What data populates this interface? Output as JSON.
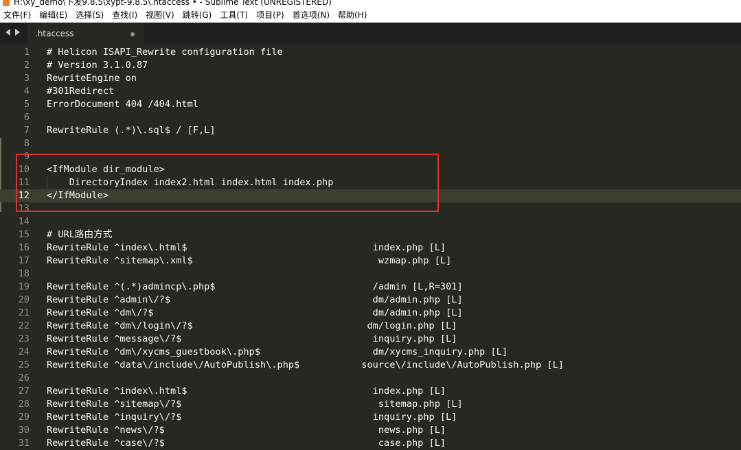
{
  "window": {
    "title": "H:\\xy_demo\\下发9.8.5\\xypt-9.8.5\\.htaccess • - Sublime Text (UNREGISTERED)"
  },
  "menu": [
    "文件(F)",
    "编辑(E)",
    "选择(S)",
    "查找(I)",
    "视图(V)",
    "跳转(G)",
    "工具(T)",
    "项目(P)",
    "首选项(N)",
    "帮助(H)"
  ],
  "tabs": [
    {
      "label": ".htaccess",
      "modified": true
    }
  ],
  "editor": {
    "current_line": 12,
    "lines": [
      {
        "n": "1",
        "text": "# Helicon ISAPI_Rewrite configuration file"
      },
      {
        "n": "2",
        "text": "# Version 3.1.0.87"
      },
      {
        "n": "3",
        "text": "RewriteEngine on"
      },
      {
        "n": "4",
        "text": "#301Redirect"
      },
      {
        "n": "5",
        "text": "ErrorDocument 404 /404.html"
      },
      {
        "n": "6",
        "text": ""
      },
      {
        "n": "7",
        "text": "RewriteRule (.*)\\.sql$ / [F,L]"
      },
      {
        "n": "8",
        "text": ""
      },
      {
        "n": "9",
        "text": ""
      },
      {
        "n": "10",
        "text": "<IfModule dir_module>"
      },
      {
        "n": "11",
        "text": "    DirectoryIndex index2.html index.html index.php"
      },
      {
        "n": "12",
        "text": "</IfModule>"
      },
      {
        "n": "13",
        "text": ""
      },
      {
        "n": "14",
        "text": ""
      },
      {
        "n": "15",
        "text": "# URL路由方式"
      },
      {
        "n": "16",
        "text": "RewriteRule ^index\\.html$                                 index.php [L]"
      },
      {
        "n": "17",
        "text": "RewriteRule ^sitemap\\.xml$                                 wzmap.php [L]"
      },
      {
        "n": "18",
        "text": ""
      },
      {
        "n": "19",
        "text": "RewriteRule ^(.*)admincp\\.php$                            /admin [L,R=301]"
      },
      {
        "n": "20",
        "text": "RewriteRule ^admin\\/?$                                    dm/admin.php [L]"
      },
      {
        "n": "21",
        "text": "RewriteRule ^dm\\/?$                                       dm/admin.php [L]"
      },
      {
        "n": "22",
        "text": "RewriteRule ^dm\\/login\\/?$                               dm/login.php [L]"
      },
      {
        "n": "23",
        "text": "RewriteRule ^message\\/?$                                  inquiry.php [L]"
      },
      {
        "n": "24",
        "text": "RewriteRule ^dm\\/xycms_guestbook\\.php$                    dm/xycms_inquiry.php [L]"
      },
      {
        "n": "25",
        "text": "RewriteRule ^data\\/include\\/AutoPublish\\.php$           source\\/include\\/AutoPublish.php [L]"
      },
      {
        "n": "26",
        "text": ""
      },
      {
        "n": "27",
        "text": "RewriteRule ^index\\.html$                                 index.php [L]"
      },
      {
        "n": "28",
        "text": "RewriteRule ^sitemap\\/?$                                   sitemap.php [L]"
      },
      {
        "n": "29",
        "text": "RewriteRule ^inquiry\\/?$                                  inquiry.php [L]"
      },
      {
        "n": "30",
        "text": "RewriteRule ^news\\/?$                                      news.php [L]"
      },
      {
        "n": "31",
        "text": "RewriteRule ^case\\/?$                                      case.php [L]"
      }
    ]
  },
  "colors": {
    "background": "#272822",
    "text": "#f8f8f2",
    "gutter": "#8f908a",
    "current_line": "#3e3d32",
    "annotation_box": "#e0312d"
  }
}
